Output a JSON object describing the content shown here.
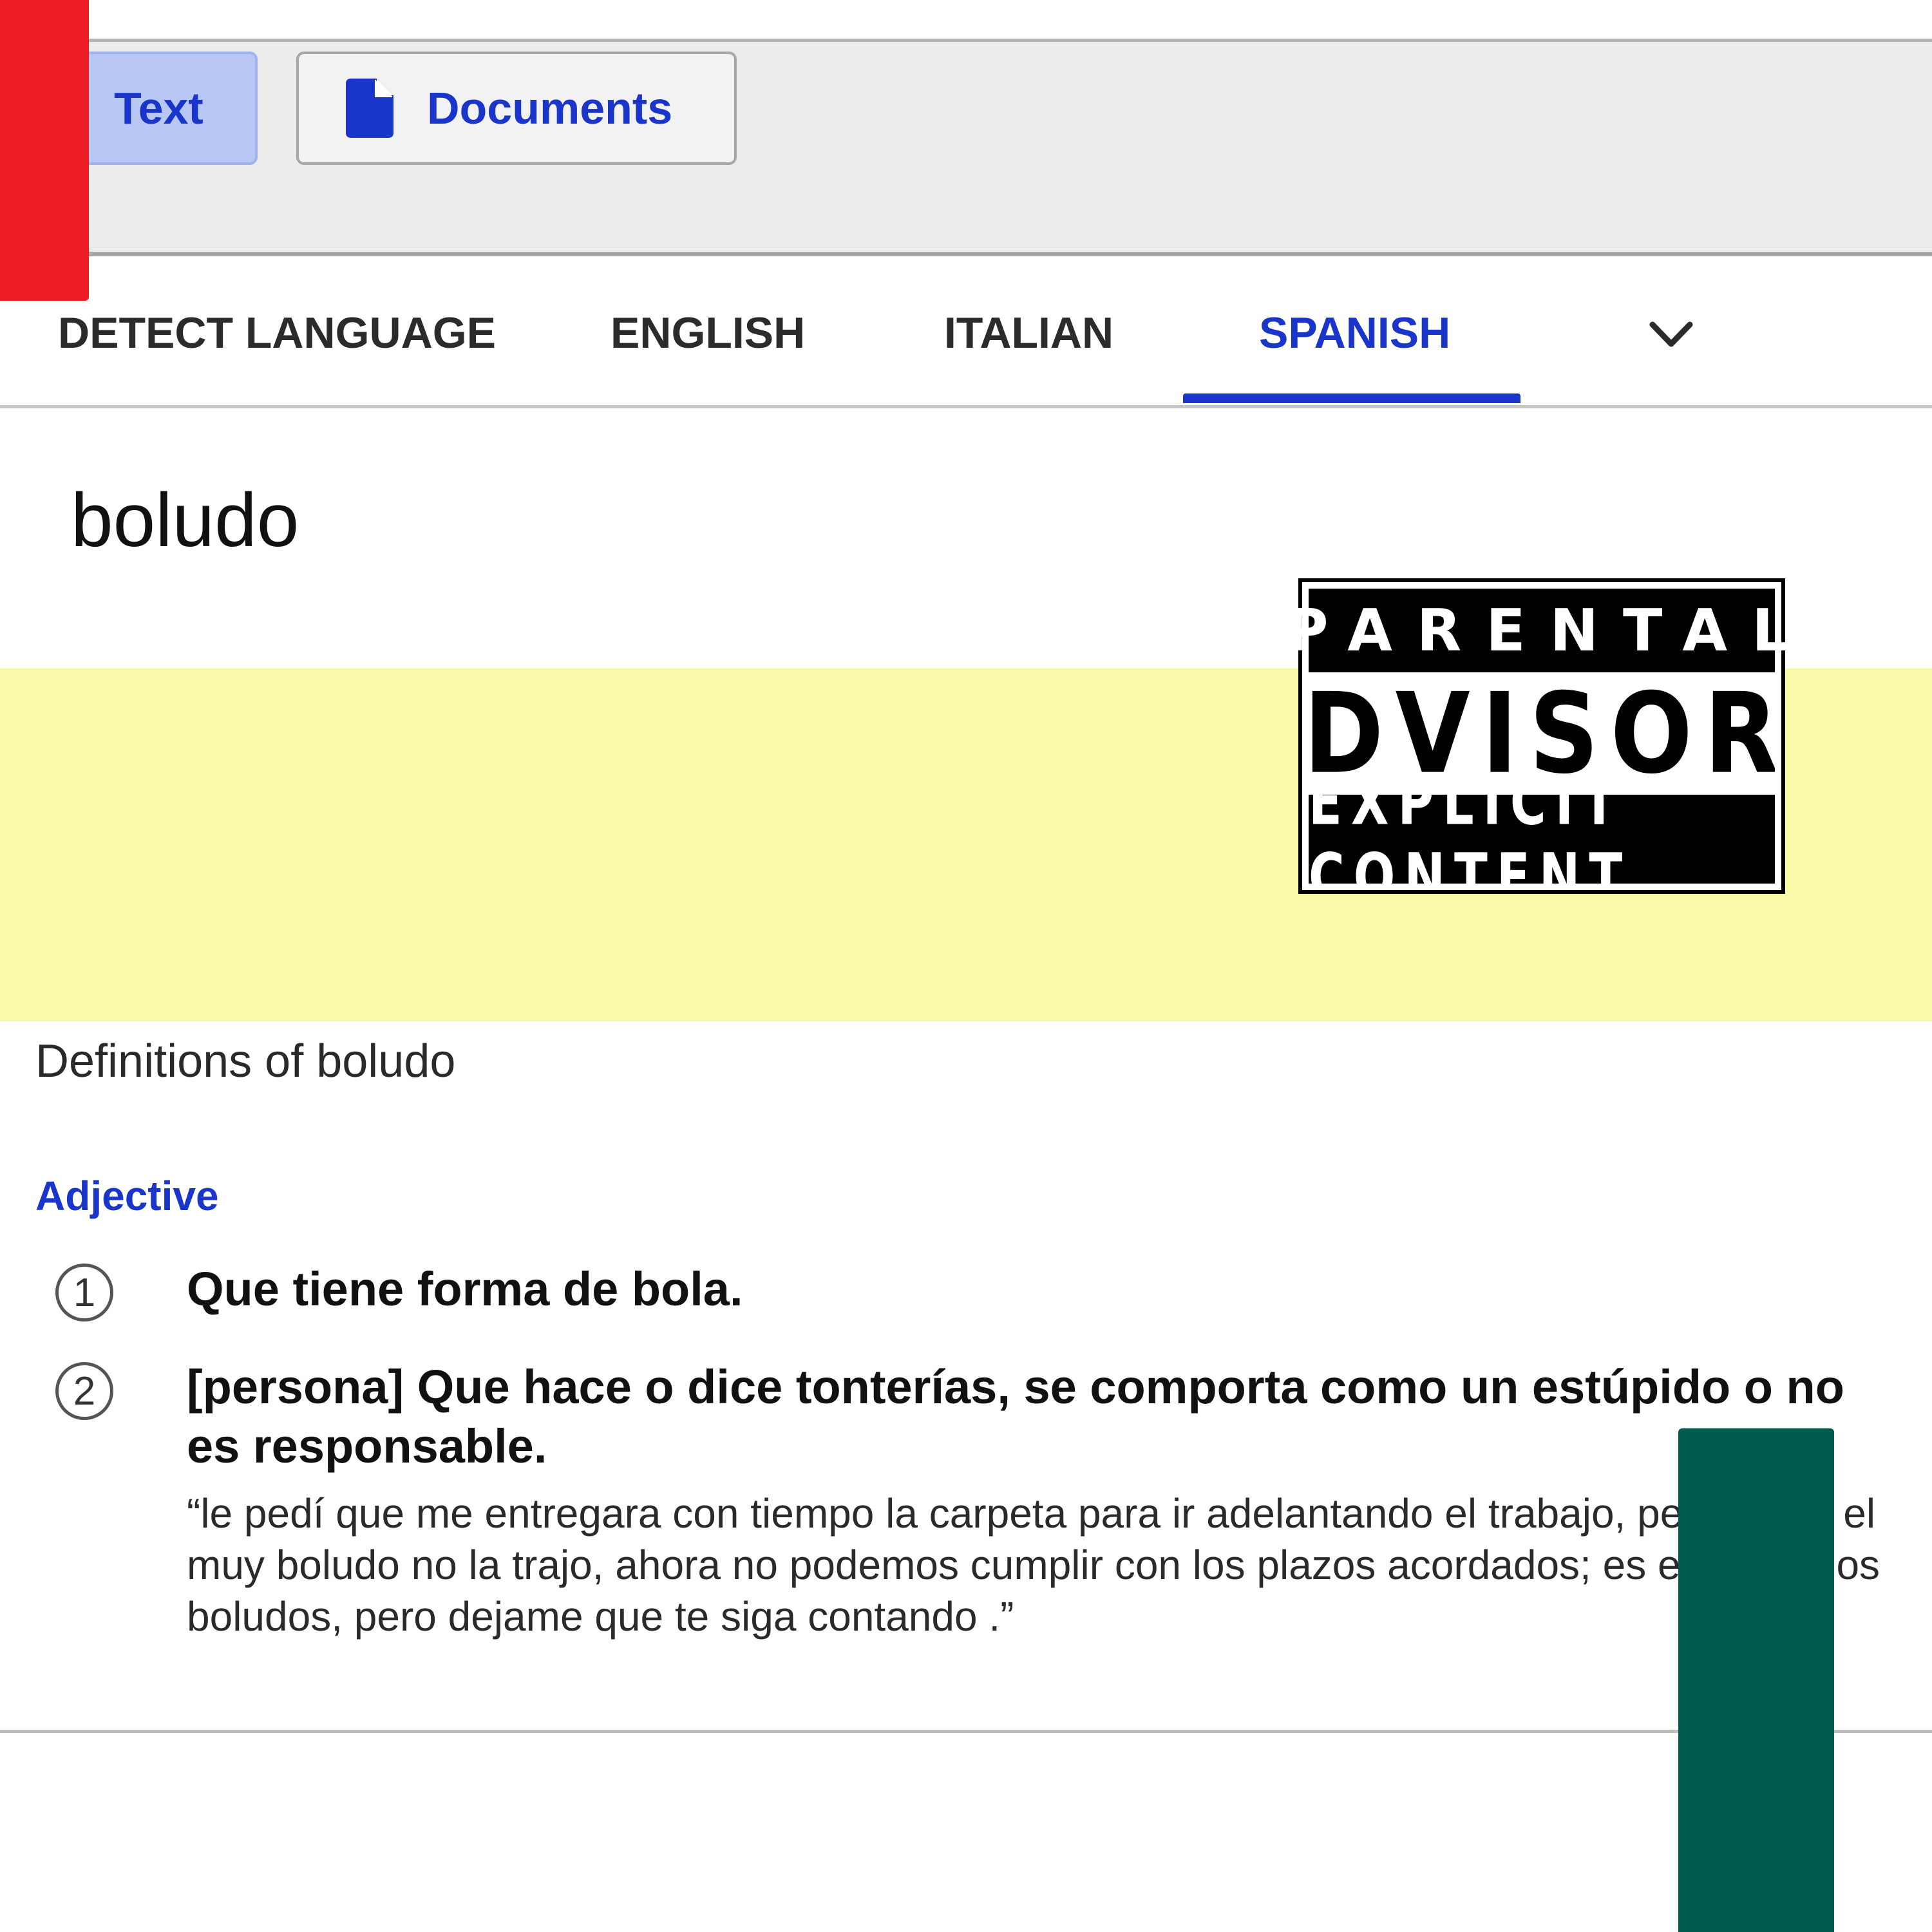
{
  "modes": {
    "text_label": "Text",
    "documents_label": "Documents",
    "documents_icon": "document-icon"
  },
  "languages": {
    "tabs": [
      "DETECT LANGUAGE",
      "ENGLISH",
      "ITALIAN",
      "SPANISH"
    ],
    "selected": "SPANISH",
    "more_icon": "chevron-down-icon"
  },
  "source": {
    "text": "boludo"
  },
  "advisory": {
    "line1": "PARENTAL",
    "line2": "ADVISORY",
    "line3": "EXPLICIT CONTENT"
  },
  "definitions": {
    "heading": "Definitions of boludo",
    "part_of_speech": "Adjective",
    "items": [
      {
        "number": "1",
        "text": "Que tiene forma de bola."
      },
      {
        "number": "2",
        "text": "[persona] Que hace o dice tonterías, se comporta como un estúpido o no es responsable.",
        "example": "“le pedí que me entregara con tiempo la carpeta para ir adelantando el trabajo, pero como el muy boludo no la trajo, ahora no podemos cumplir con los plazos acordados; es el rey de los boludos, pero dejame que te siga contando .”"
      }
    ]
  },
  "colors": {
    "accent": "#1a35c9",
    "tab_selected_bg": "#b8c7f3",
    "highlight_band": "#f9f9aa",
    "red_block": "#ec1c24",
    "green_block": "#005b4f"
  }
}
